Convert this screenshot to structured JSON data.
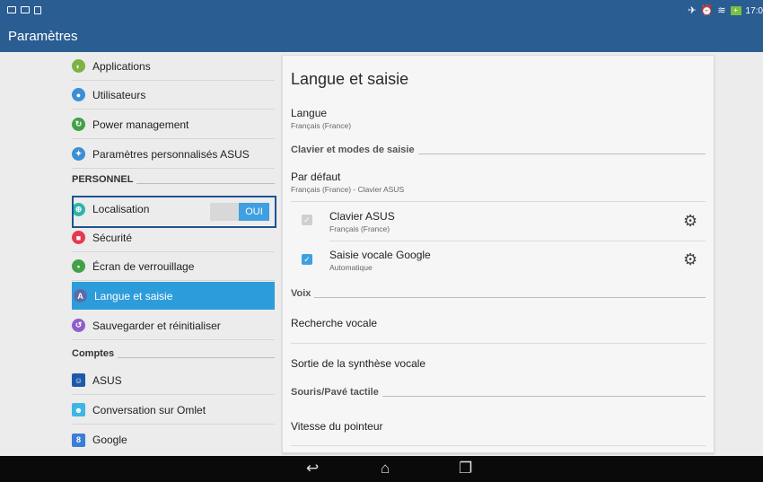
{
  "statusbar": {
    "time": "17:0",
    "battery": "+"
  },
  "appbar": {
    "title": "Paramètres"
  },
  "sidebar": {
    "items_top": [
      {
        "label": "Applications",
        "icon": "applications-icon",
        "color": "#7cb342"
      },
      {
        "label": "Utilisateurs",
        "icon": "users-icon",
        "color": "#3b8fd6"
      },
      {
        "label": "Power management",
        "icon": "power-icon",
        "color": "#43a047"
      },
      {
        "label": "Paramètres personnalisés ASUS",
        "icon": "asus-custom-icon",
        "color": "#3b8fd6"
      }
    ],
    "section_personnel": "PERSONNEL",
    "localisation": {
      "label": "Localisation",
      "toggle": "OUI",
      "color": "#2db5a8"
    },
    "items_personnel": [
      {
        "label": "Sécurité",
        "icon": "lock-icon",
        "color": "#e53950"
      },
      {
        "label": "Écran de verrouillage",
        "icon": "lock-screen-icon",
        "color": "#43a047"
      },
      {
        "label": "Langue et saisie",
        "icon": "language-icon",
        "color": "#5b6ba8"
      },
      {
        "label": "Sauvegarder et réinitialiser",
        "icon": "backup-icon",
        "color": "#8e5ec9"
      }
    ],
    "section_comptes": "Comptes",
    "items_comptes": [
      {
        "label": "ASUS",
        "icon": "asus-account-icon",
        "color": "#1e5aa8"
      },
      {
        "label": "Conversation sur Omlet",
        "icon": "omlet-icon",
        "color": "#3fb5e5"
      },
      {
        "label": "Google",
        "icon": "google-icon",
        "color": "#3b7dd8"
      }
    ]
  },
  "panel": {
    "title": "Langue et saisie",
    "langue": {
      "label": "Langue",
      "value": "Français (France)"
    },
    "section_keyboard": "Clavier et modes de saisie",
    "default": {
      "label": "Par défaut",
      "value": "Français (France) - Clavier ASUS"
    },
    "asus_keyboard": {
      "label": "Clavier ASUS",
      "value": "Français (France)"
    },
    "google_voice": {
      "label": "Saisie vocale Google",
      "value": "Automatique"
    },
    "section_voice": "Voix",
    "voice_search": "Recherche vocale",
    "tts": "Sortie de la synthèse vocale",
    "section_mouse": "Souris/Pavé tactile",
    "pointer_speed": "Vitesse du pointeur"
  }
}
